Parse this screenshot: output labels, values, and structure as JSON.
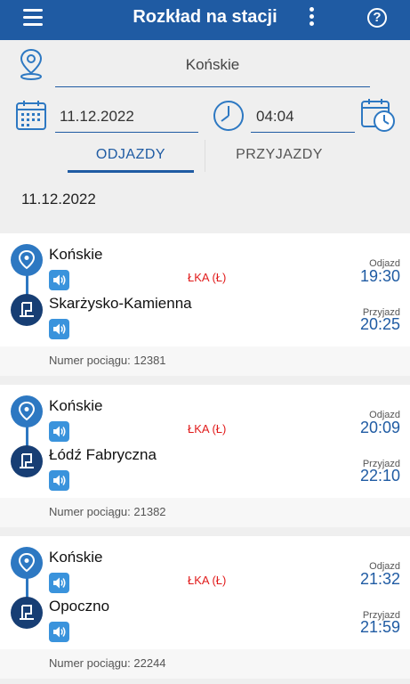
{
  "header": {
    "title": "Rozkład na stacji",
    "menu_icon": "hamburger-menu-icon",
    "more_icon": "more-vertical-icon",
    "help_icon": "help-circle-icon",
    "help_glyph": "?"
  },
  "search": {
    "station": "Końskie",
    "date": "11.12.2022",
    "time": "04:04"
  },
  "tabs": {
    "departures": "ODJAZDY",
    "arrivals": "PRZYJAZDY",
    "active": "departures"
  },
  "list_date": "11.12.2022",
  "connections": [
    {
      "from": "Końskie",
      "to": "Skarżysko-Kamienna",
      "carrier": "ŁKA (Ł)",
      "departure_label": "Odjazd",
      "departure_time": "19:30",
      "arrival_label": "Przyjazd",
      "arrival_time": "20:25",
      "train_number": "Numer pociągu: 12381"
    },
    {
      "from": "Końskie",
      "to": "Łódź Fabryczna",
      "carrier": "ŁKA (Ł)",
      "departure_label": "Odjazd",
      "departure_time": "20:09",
      "arrival_label": "Przyjazd",
      "arrival_time": "22:10",
      "train_number": "Numer pociągu: 21382"
    },
    {
      "from": "Końskie",
      "to": "Opoczno",
      "carrier": "ŁKA (Ł)",
      "departure_label": "Odjazd",
      "departure_time": "21:32",
      "arrival_label": "Przyjazd",
      "arrival_time": "21:59",
      "train_number": "Numer pociągu: 22244"
    }
  ],
  "colors": {
    "primary": "#1f5ba3",
    "pin": "#2d78c2",
    "train": "#173e74",
    "speaker": "#3a93dc",
    "carrier": "#e11b1b"
  }
}
